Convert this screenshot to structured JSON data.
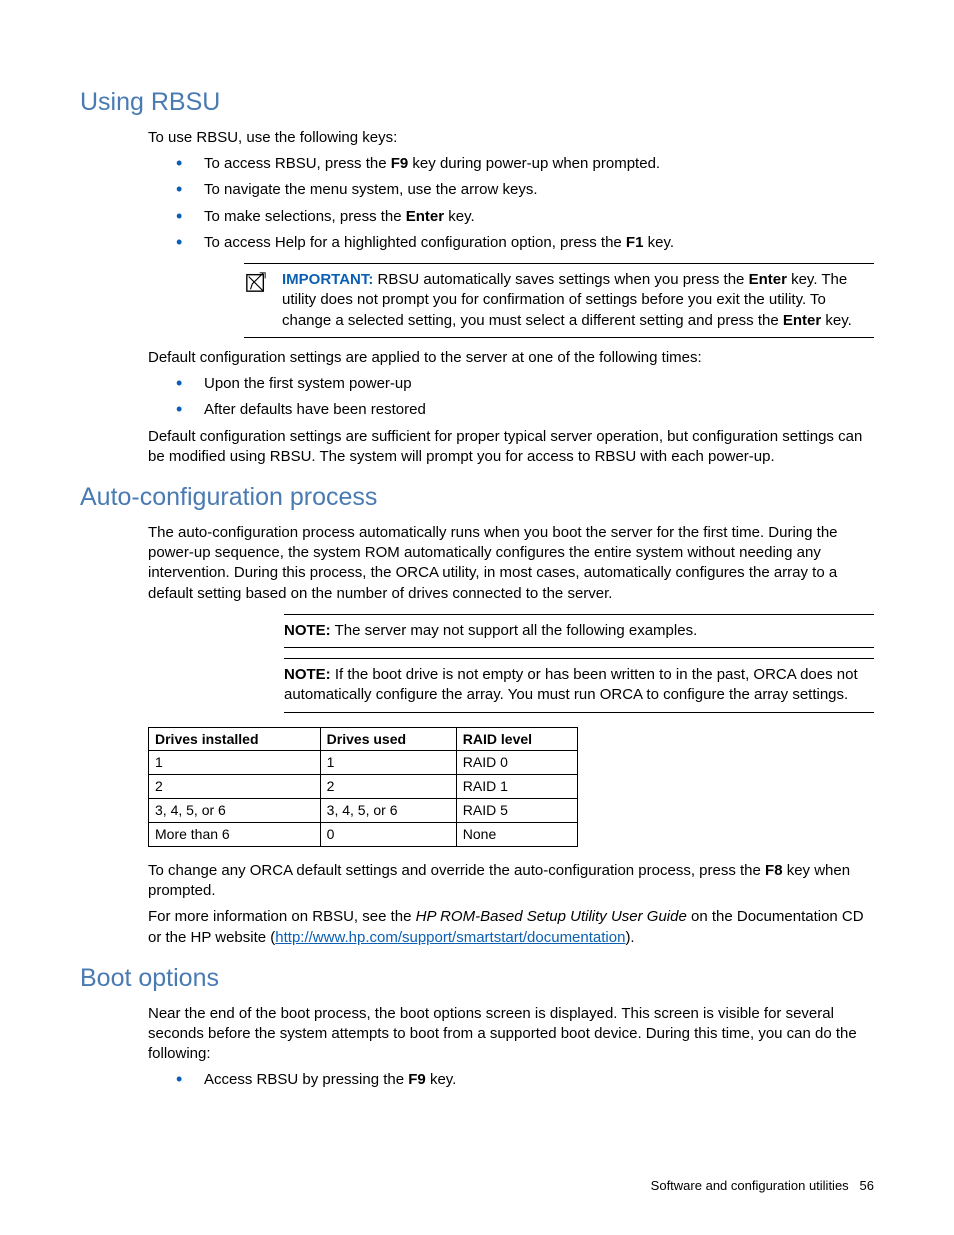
{
  "sec1": {
    "title": "Using RBSU",
    "intro": "To use RBSU, use the following keys:",
    "b1_pre": "To access RBSU, press the ",
    "b1_key": "F9",
    "b1_post": " key during power-up when prompted.",
    "b2": "To navigate the menu system, use the arrow keys.",
    "b3_pre": "To make selections, press the ",
    "b3_key": "Enter",
    "b3_post": " key.",
    "b4_pre": "To access Help for a highlighted configuration option, press the ",
    "b4_key": "F1",
    "b4_post": " key.",
    "important_label": "IMPORTANT:",
    "important_1": "  RBSU automatically saves settings when you press the ",
    "important_key1": "Enter",
    "important_2": " key. The utility does not prompt you for confirmation of settings before you exit the utility. To change a selected setting, you must select a different setting and press the ",
    "important_key2": "Enter",
    "important_3": " key.",
    "defaults_intro": "Default configuration settings are applied to the server at one of the following times:",
    "d1": "Upon the first system power-up",
    "d2": "After defaults have been restored",
    "defaults_out": "Default configuration settings are sufficient for proper typical server operation, but configuration settings can be modified using RBSU. The system will prompt you for access to RBSU with each power-up."
  },
  "sec2": {
    "title": "Auto-configuration process",
    "p1": "The auto-configuration process automatically runs when you boot the server for the first time. During the power-up sequence, the system ROM automatically configures the entire system without needing any intervention. During this process, the ORCA utility, in most cases, automatically configures the array to a default setting based on the number of drives connected to the server.",
    "note1_label": "NOTE:",
    "note1_text": "  The server may not support all the following examples.",
    "note2_label": "NOTE:",
    "note2_text": "  If the boot drive is not empty or has been written to in the past, ORCA does not automatically configure the array. You must run ORCA to configure the array settings.",
    "table": {
      "h1": "Drives installed",
      "h2": "Drives used",
      "h3": "RAID level",
      "rows": [
        {
          "c1": "1",
          "c2": "1",
          "c3": "RAID 0"
        },
        {
          "c1": "2",
          "c2": "2",
          "c3": "RAID 1"
        },
        {
          "c1": "3, 4, 5, or 6",
          "c2": "3, 4, 5, or 6",
          "c3": "RAID 5"
        },
        {
          "c1": "More than 6",
          "c2": "0",
          "c3": "None"
        }
      ]
    },
    "after_table_pre": "To change any ORCA default settings and override the auto-configuration process, press the ",
    "after_table_key": "F8",
    "after_table_post": " key when prompted.",
    "more_pre": "For more information on RBSU, see the ",
    "more_guide": "HP ROM-Based Setup Utility User Guide",
    "more_mid": " on the Documentation CD or the HP website (",
    "more_link": "http://www.hp.com/support/smartstart/documentation",
    "more_post": ")."
  },
  "sec3": {
    "title": "Boot options",
    "p1": "Near the end of the boot process, the boot options screen is displayed. This screen is visible for several seconds before the system attempts to boot from a supported boot device. During this time, you can do the following:",
    "b1_pre": "Access RBSU by pressing the ",
    "b1_key": "F9",
    "b1_post": " key."
  },
  "footer": {
    "text": "Software and configuration utilities",
    "page": "56"
  }
}
